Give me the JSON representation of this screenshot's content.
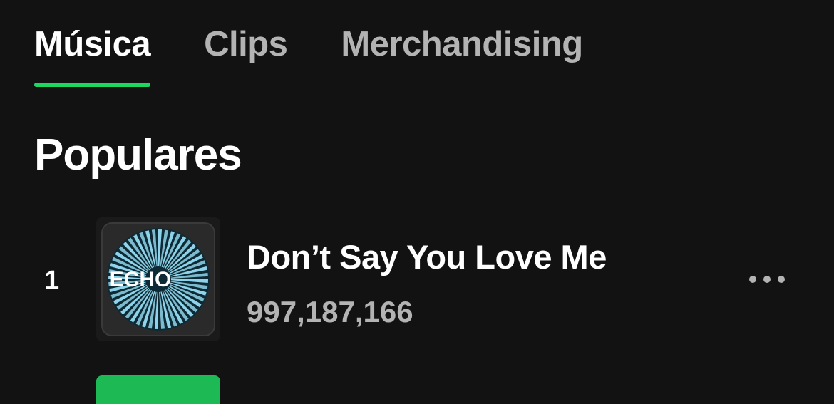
{
  "tabs": [
    {
      "label": "Música",
      "active": true
    },
    {
      "label": "Clips",
      "active": false
    },
    {
      "label": "Merchandising",
      "active": false
    }
  ],
  "section": {
    "title": "Populares"
  },
  "tracks": [
    {
      "rank": "1",
      "title": "Don’t Say You Love Me",
      "plays": "997,187,166",
      "cover_text": "ECHO"
    }
  ],
  "icons": {
    "more": "more-options-icon"
  },
  "colors": {
    "background": "#121212",
    "accent": "#1ed760",
    "primary_text": "#ffffff",
    "secondary_text": "#b3b3b3",
    "cover_blue": "#8fd3ea",
    "next_cover": "#1db954"
  }
}
